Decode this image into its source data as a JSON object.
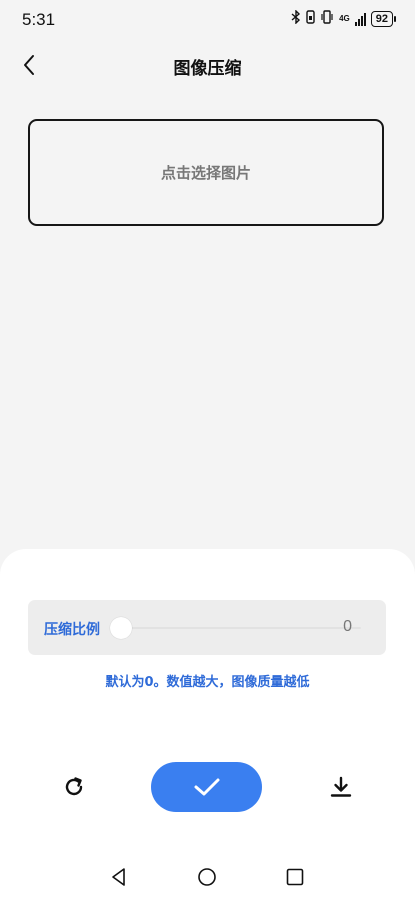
{
  "status_bar": {
    "time": "5:31",
    "network": "4G",
    "battery": "92"
  },
  "header": {
    "title": "图像压缩"
  },
  "picker": {
    "label": "点击选择图片"
  },
  "compression": {
    "label": "压缩比例",
    "value": "0",
    "level_fraction": 0,
    "hint": "默认为0。数值越大，图像质量越低"
  },
  "colors": {
    "accent": "#3a7ff0",
    "label_blue": "#2f6bd8",
    "background": "#f4f4f4"
  },
  "icons": {
    "back": "chevron-left-icon",
    "refresh": "refresh-icon",
    "confirm": "check-icon",
    "download": "download-icon",
    "nav_back": "triangle-back-icon",
    "nav_home": "circle-home-icon",
    "nav_recents": "square-recents-icon"
  }
}
